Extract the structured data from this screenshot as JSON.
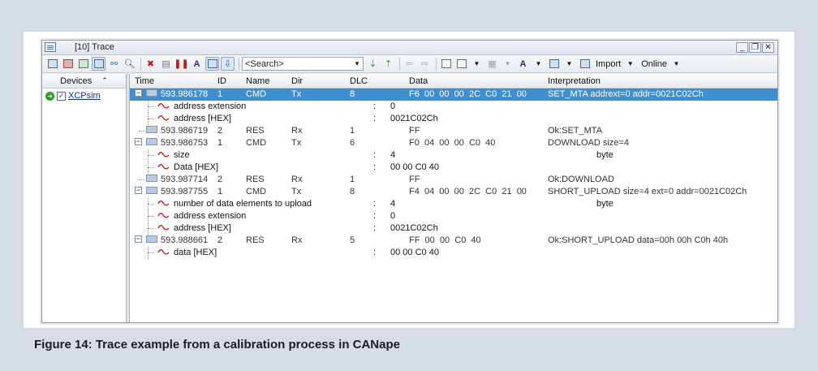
{
  "window": {
    "title": "[10] Trace",
    "buttons": {
      "minimize": "_",
      "restore": "❐",
      "close": "✕"
    }
  },
  "toolbar": {
    "search_placeholder": "<Search>",
    "import_label": "Import",
    "online_label": "Online"
  },
  "devices": {
    "header": "Devices",
    "items": [
      {
        "label": "XCPsim",
        "checked": true
      }
    ]
  },
  "trace": {
    "columns": {
      "time": "Time",
      "id": "ID",
      "name": "Name",
      "dir": "Dir",
      "dlc": "DLC",
      "data": "Data",
      "interpretation": "Interpretation"
    },
    "rows": [
      {
        "kind": "msg",
        "expandable": true,
        "time": "593.986178",
        "id": "1",
        "name": "CMD",
        "dir": "Tx",
        "dlc": "8",
        "data": "F6  00  00  00  2C  C0  21  00",
        "interp": "SET_MTA addrext=0 addr=0021C02Ch",
        "selected": true
      },
      {
        "kind": "sig",
        "name": "address extension",
        "colon": ":",
        "value": "0",
        "interp": ""
      },
      {
        "kind": "sig",
        "name": "address [HEX]",
        "colon": ":",
        "value": "0021C02Ch",
        "interp": ""
      },
      {
        "kind": "msg",
        "expandable": false,
        "time": "593.986719",
        "id": "2",
        "name": "RES",
        "dir": "Rx",
        "dlc": "1",
        "data": "FF",
        "interp": "Ok:SET_MTA"
      },
      {
        "kind": "msg",
        "expandable": true,
        "time": "593.986753",
        "id": "1",
        "name": "CMD",
        "dir": "Tx",
        "dlc": "6",
        "data": "F0  04  00  00  C0  40",
        "interp": "DOWNLOAD size=4"
      },
      {
        "kind": "sig",
        "name": "size",
        "colon": ":",
        "value": "4",
        "interp": "byte"
      },
      {
        "kind": "sig",
        "name": "Data [HEX]",
        "colon": ":",
        "value": "00 00 C0 40",
        "interp": ""
      },
      {
        "kind": "msg",
        "expandable": false,
        "time": "593.987714",
        "id": "2",
        "name": "RES",
        "dir": "Rx",
        "dlc": "1",
        "data": "FF",
        "interp": "Ok:DOWNLOAD"
      },
      {
        "kind": "msg",
        "expandable": true,
        "time": "593.987755",
        "id": "1",
        "name": "CMD",
        "dir": "Tx",
        "dlc": "8",
        "data": "F4  04  00  00  2C  C0  21  00",
        "interp": "SHORT_UPLOAD size=4 ext=0 addr=0021C02Ch"
      },
      {
        "kind": "sig",
        "name": "number of data elements to upload",
        "colon": ":",
        "value": "4",
        "interp": "byte"
      },
      {
        "kind": "sig",
        "name": "address extension",
        "colon": ":",
        "value": "0",
        "interp": ""
      },
      {
        "kind": "sig",
        "name": "address [HEX]",
        "colon": ":",
        "value": "0021C02Ch",
        "interp": ""
      },
      {
        "kind": "msg",
        "expandable": true,
        "time": "593.988661",
        "id": "2",
        "name": "RES",
        "dir": "Rx",
        "dlc": "5",
        "data": "FF  00  00  C0  40",
        "interp": "Ok:SHORT_UPLOAD data=00h 00h C0h 40h"
      },
      {
        "kind": "sig",
        "name": "data [HEX]",
        "colon": ":",
        "value": "00 00 C0 40",
        "interp": ""
      }
    ]
  },
  "caption": "Figure 14: Trace example from a calibration process in CANape",
  "colors": {
    "selection": "#3d8fd3",
    "background": "#d7dde5"
  }
}
